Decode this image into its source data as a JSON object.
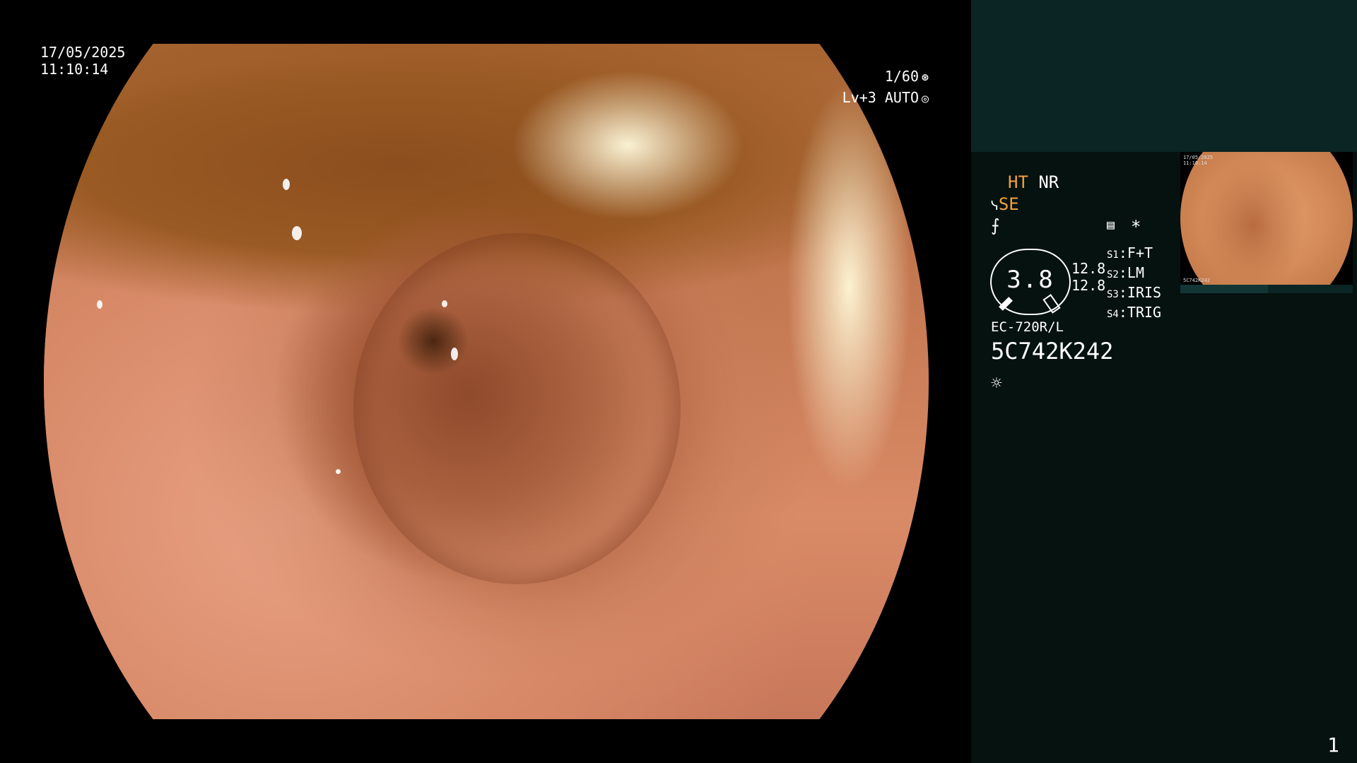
{
  "overlay": {
    "date": "17/05/2025",
    "time": "11:10:14",
    "shutter": "1/60",
    "level": "Lv+3",
    "exposure_mode": "AUTO"
  },
  "panel": {
    "enhance_1": "HT",
    "enhance_2": "NR",
    "structure_mode": "SE",
    "gauge_value": "3.8",
    "gauge_left_top": "12.8",
    "gauge_left_bottom": "12.8",
    "switches": [
      {
        "key": "S1",
        "value": "F+T"
      },
      {
        "key": "S2",
        "value": "LM"
      },
      {
        "key": "S3",
        "value": "IRIS"
      },
      {
        "key": "S4",
        "value": "TRIG"
      }
    ],
    "scope_model": "EC-720R/L",
    "serial": "5C742K242",
    "asterisk": "*",
    "page_number": "1"
  },
  "thumbnail": {
    "date": "17/05/2025",
    "time": "11:10:14",
    "serial": "5C742K242"
  },
  "icons": {
    "shutter_icon": "aperture-icon",
    "exposure_icon": "auto-exposure-icon",
    "scope_icon": "scope-icon",
    "zoom_icon": "zoom-icon",
    "memo_icon": "memo-icon",
    "light_icon": "sun-icon"
  },
  "colors": {
    "accent": "#f2a23a",
    "panel_background": "#061210",
    "panel_band": "#0b2424"
  }
}
